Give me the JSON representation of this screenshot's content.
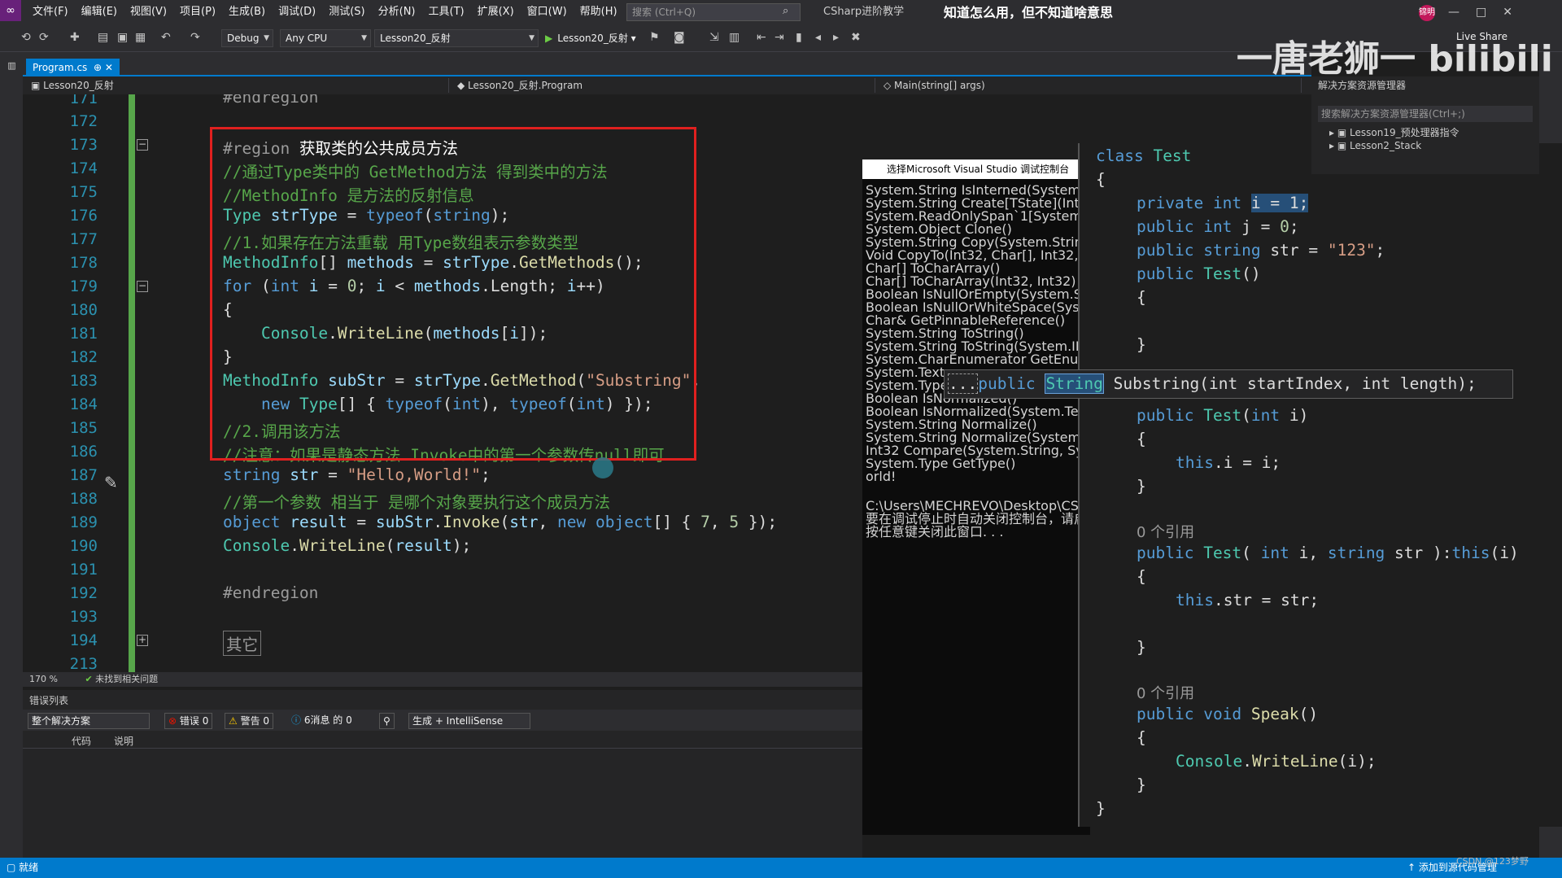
{
  "menubar": {
    "items": [
      "文件(F)",
      "编辑(E)",
      "视图(V)",
      "项目(P)",
      "生成(B)",
      "调试(D)",
      "测试(S)",
      "分析(N)",
      "工具(T)",
      "扩展(X)",
      "窗口(W)",
      "帮助(H)"
    ],
    "search_placeholder": "搜索 (Ctrl+Q)",
    "solution_name": "CSharp进阶教学",
    "video_caption": "知道怎么用，但不知道啥意思",
    "user_badge": "锦明"
  },
  "toolbar": {
    "config": "Debug",
    "platform": "Any CPU",
    "project": "Lesson20_反射",
    "start_label": "Lesson20_反射",
    "live_share": "Live Share"
  },
  "tabs": [
    {
      "label": "Program.cs"
    }
  ],
  "navbar": {
    "project": "Lesson20_反射",
    "type": "Lesson20_反射.Program",
    "member": "Main(string[] args)"
  },
  "editor": {
    "line_numbers": [
      "171",
      "172",
      "173",
      "174",
      "175",
      "176",
      "177",
      "178",
      "179",
      "180",
      "181",
      "182",
      "183",
      "184",
      "185",
      "186",
      "187",
      "188",
      "189",
      "190",
      "191",
      "192",
      "193",
      "194",
      "213"
    ],
    "zoom": "170 %",
    "issues": "未找到相关问题",
    "collapsed_region": "其它"
  },
  "error_list": {
    "title": "错误列表",
    "scope": "整个解决方案",
    "errors": "错误 0",
    "warnings": "警告 0",
    "messages": "6消息 的 0",
    "source": "生成 + IntelliSense",
    "col_code": "代码",
    "col_desc": "说明"
  },
  "console": {
    "title": "选择Microsoft Visual Studio 调试控制台",
    "lines": [
      "System.String IsInterned(System.Str",
      "System.String Create[TState](Int32,",
      "System.ReadOnlySpan`1[System.Char]",
      "System.Object Clone()",
      "System.String Copy(System.String)",
      "Void CopyTo(Int32, Char[], Int32, I",
      "Char[] ToCharArray()",
      "Char[] ToCharArray(Int32, Int32)",
      "Boolean IsNullOrEmpty(System.Stri",
      "Boolean IsNullOrWhiteSpace(System",
      "Char& GetPinnableReference()",
      "System.String ToString()",
      "System.String ToString(System.IFo",
      "System.CharEnumerator GetEnumerat",
      "System.Text.",
      "System.TypeC",
      "Boolean IsNormalized()",
      "Boolean IsNormalized(System.Text.",
      "System.String Normalize()",
      "System.String Normalize(System.Te",
      "Int32 Compare(System.String, Syst",
      "System.Type GetType()",
      "orld!",
      "",
      "C:\\Users\\MECHREVO\\Desktop\\CSharp进",
      "要在调试停止时自动关闭控制台，请启",
      "按任意键关闭此窗口. . ."
    ]
  },
  "tooltip": {
    "text": "Substring(int startIndex, int length);",
    "prefix": "...",
    "modifier": "public",
    "return_type": "String"
  },
  "class_popup": {
    "ref_label": "0 个引用"
  },
  "solution_explorer": {
    "title": "解决方案资源管理器",
    "search_placeholder": "搜索解决方案资源管理器(Ctrl+;)",
    "items": [
      "Lesson19_预处理器指令",
      "Lesson2_Stack"
    ]
  },
  "watermark": "一唐老狮一 bilibili",
  "statusbar": {
    "left": "就绪",
    "right": "添加到源代码管理",
    "csdn": "CSDN @123梦野"
  }
}
